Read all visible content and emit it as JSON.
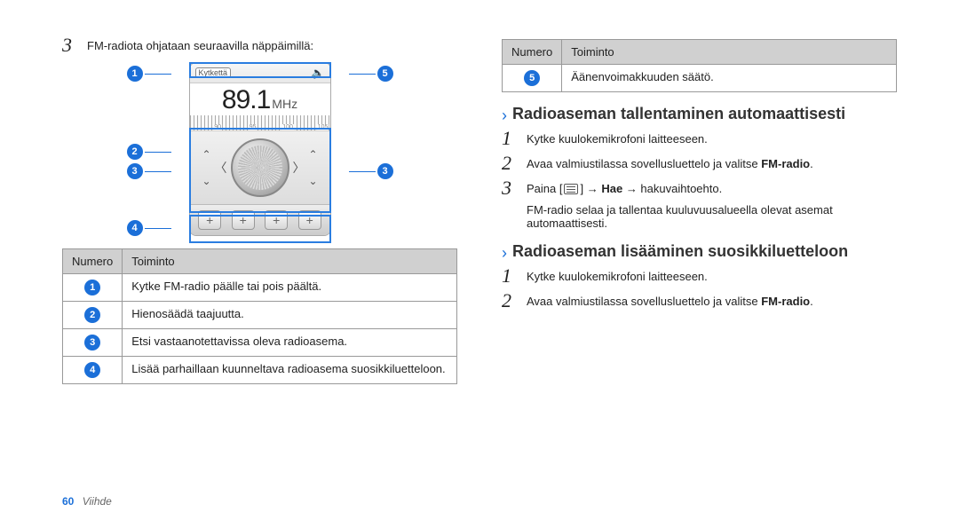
{
  "left": {
    "step3_intro": "FM-radiota ohjataan seuraavilla näppäimillä:",
    "freq_value": "89.1",
    "freq_unit": "MHz",
    "power_label": "Kytkettä",
    "ruler_ticks": [
      "90",
      "95",
      "100",
      "105"
    ],
    "table": {
      "head_num": "Numero",
      "head_fn": "Toiminto",
      "rows": [
        {
          "n": "1",
          "fn": "Kytke FM-radio päälle tai pois päältä."
        },
        {
          "n": "2",
          "fn": "Hienosäädä taajuutta."
        },
        {
          "n": "3",
          "fn": "Etsi vastaanotettavissa oleva radioasema."
        },
        {
          "n": "4",
          "fn": "Lisää parhaillaan kuunneltava radioasema suosikkiluetteloon."
        }
      ]
    }
  },
  "right": {
    "table": {
      "head_num": "Numero",
      "head_fn": "Toiminto",
      "rows": [
        {
          "n": "5",
          "fn": "Äänenvoimakkuuden säätö."
        }
      ]
    },
    "sectionA_title": "Radioaseman tallentaminen automaattisesti",
    "sectionA_steps": [
      "Kytke kuulokemikrofoni laitteeseen.",
      "Avaa valmiustilassa sovellusluettelo ja valitse ",
      "Paina [",
      "FM-radio selaa ja tallentaa kuuluvuusalueella olevat asemat automaattisesti."
    ],
    "sectionA_bold_app": "FM-radio",
    "sectionA_step3_mid": " → ",
    "sectionA_step3_bold": "Hae",
    "sectionA_step3_tail": " → hakuvaihtoehto.",
    "sectionB_title": "Radioaseman lisääminen suosikkiluetteloon",
    "sectionB_steps": [
      "Kytke kuulokemikrofoni laitteeseen.",
      "Avaa valmiustilassa sovellusluettelo ja valitse "
    ],
    "sectionB_bold_app": "FM-radio"
  },
  "footer": {
    "page": "60",
    "section": "Viihde"
  }
}
